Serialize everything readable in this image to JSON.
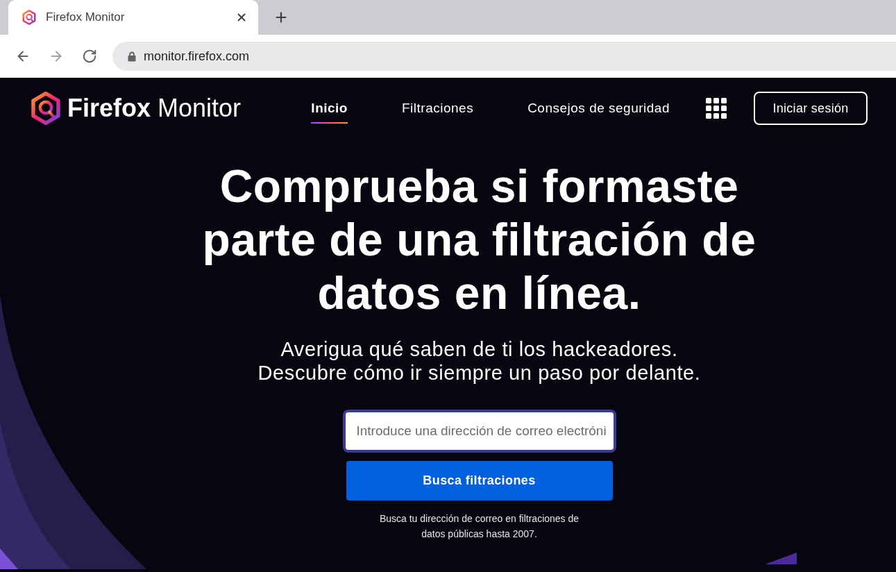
{
  "browser": {
    "tab": {
      "title": "Firefox Monitor"
    },
    "toolbar_buttons": [
      {
        "kind": "back",
        "disabled": false
      },
      {
        "kind": "forward",
        "disabled": true
      },
      {
        "kind": "reload",
        "disabled": false
      }
    ],
    "address_bar": {
      "url": "monitor.firefox.com"
    }
  },
  "header": {
    "logo_text": "**Firefox** Monitor",
    "nav": [
      {
        "label": "Inicio",
        "selected": true
      },
      {
        "label": "Filtraciones",
        "selected": false
      },
      {
        "label": "Consejos de seguridad",
        "selected": false
      }
    ],
    "sign_in_button": "Iniciar sesión"
  },
  "hero": {
    "title": "Comprueba si formaste parte de una filtración de datos en línea.",
    "subtitle_lines": [
      "Averigua qué saben de ti los hackeadores.",
      "Descubre cómo ir siempre un paso por delante."
    ],
    "email_field": {
      "placeholder": "Introduce una dirección de correo electróni"
    },
    "search_button": "Busca filtraciones",
    "note": "Busca tu dirección de correo en filtraciones de datos públicas hasta 2007."
  }
}
